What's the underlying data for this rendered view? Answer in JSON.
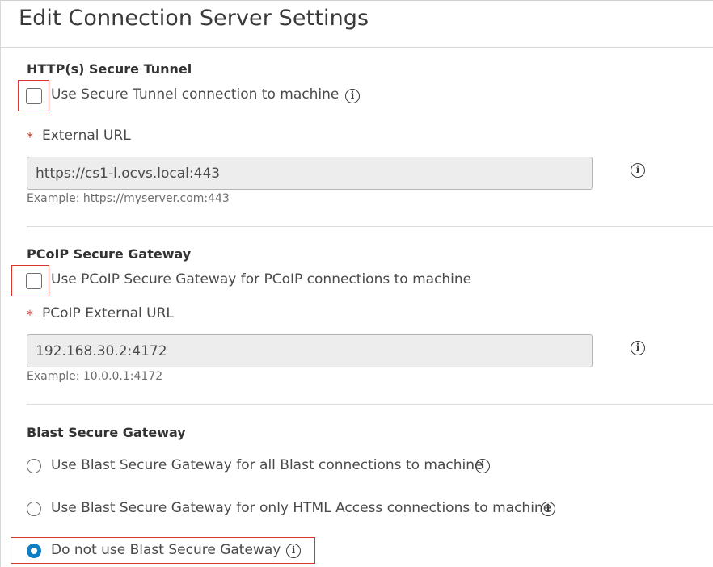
{
  "dialog": {
    "title": "Edit Connection Server Settings"
  },
  "secure_tunnel": {
    "section_title": "HTTP(s) Secure Tunnel",
    "checkbox_label": "Use Secure Tunnel connection to machine",
    "checked": false,
    "external_url": {
      "required_marker": "*",
      "label": "External URL",
      "value": "https://cs1-l.ocvs.local:443",
      "hint": "Example: https://myserver.com:443"
    }
  },
  "pcoip_gateway": {
    "section_title": "PCoIP Secure Gateway",
    "checkbox_label": "Use PCoIP Secure Gateway for PCoIP connections to machine",
    "checked": false,
    "external_url": {
      "required_marker": "*",
      "label": "PCoIP External URL",
      "value": "192.168.30.2:4172",
      "hint": "Example: 10.0.0.1:4172"
    }
  },
  "blast_gateway": {
    "section_title": "Blast Secure Gateway",
    "options": [
      {
        "label": "Use Blast Secure Gateway for all Blast connections to machine",
        "selected": false
      },
      {
        "label": "Use Blast Secure Gateway for only HTML Access connections to machine",
        "selected": false
      },
      {
        "label": "Do not use Blast Secure Gateway",
        "selected": true
      }
    ]
  },
  "icons": {
    "info": "info-icon",
    "info_glyph": "i"
  },
  "colors": {
    "highlight": "#d9342b",
    "radio_selected": "#0f7fc5",
    "required": "#c0392b"
  }
}
